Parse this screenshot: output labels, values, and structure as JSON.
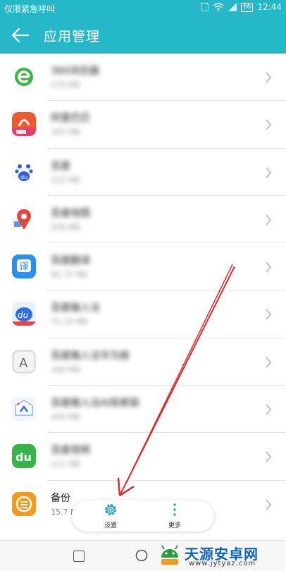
{
  "status_bar": {
    "carrier": "仅限紧急呼叫",
    "battery": "66",
    "time": "12:44"
  },
  "header": {
    "title": "应用管理"
  },
  "apps": [
    {
      "name": "360浏览器",
      "size": "278 MB",
      "blurred": true,
      "icon": "browser-360-icon"
    },
    {
      "name": "阿里巴巴",
      "size": "305 MB",
      "blurred": true,
      "icon": "alibaba-icon"
    },
    {
      "name": "百度",
      "size": "312 MB",
      "blurred": true,
      "icon": "baidu-icon"
    },
    {
      "name": "百度地图",
      "size": "208 MB",
      "blurred": true,
      "icon": "baidu-map-icon"
    },
    {
      "name": "百度翻译",
      "size": "92.75 MB",
      "blurred": true,
      "icon": "baidu-translate-icon"
    },
    {
      "name": "百度输入法",
      "size": "75.19 MB",
      "blurred": true,
      "icon": "baidu-input-icon"
    },
    {
      "name": "百度输入法华为版",
      "size": "184 MB",
      "blurred": true,
      "icon": "a-letter-icon"
    },
    {
      "name": "百度输入法AI探索版",
      "size": "400 MB",
      "blurred": true,
      "icon": "baidu-ai-icon"
    },
    {
      "name": "百度视频",
      "size": "121 MB",
      "blurred": true,
      "icon": "du-icon"
    },
    {
      "name": "备份",
      "size": "15.7 MB",
      "blurred": false,
      "icon": "backup-icon"
    }
  ],
  "toolbar": {
    "settings_label": "设置",
    "more_label": "更多"
  },
  "watermark": {
    "name": "天源安卓网",
    "url": "www.jytyaz.com"
  },
  "colors": {
    "accent": "#26b8c8",
    "arrow": "#d62d2d"
  }
}
